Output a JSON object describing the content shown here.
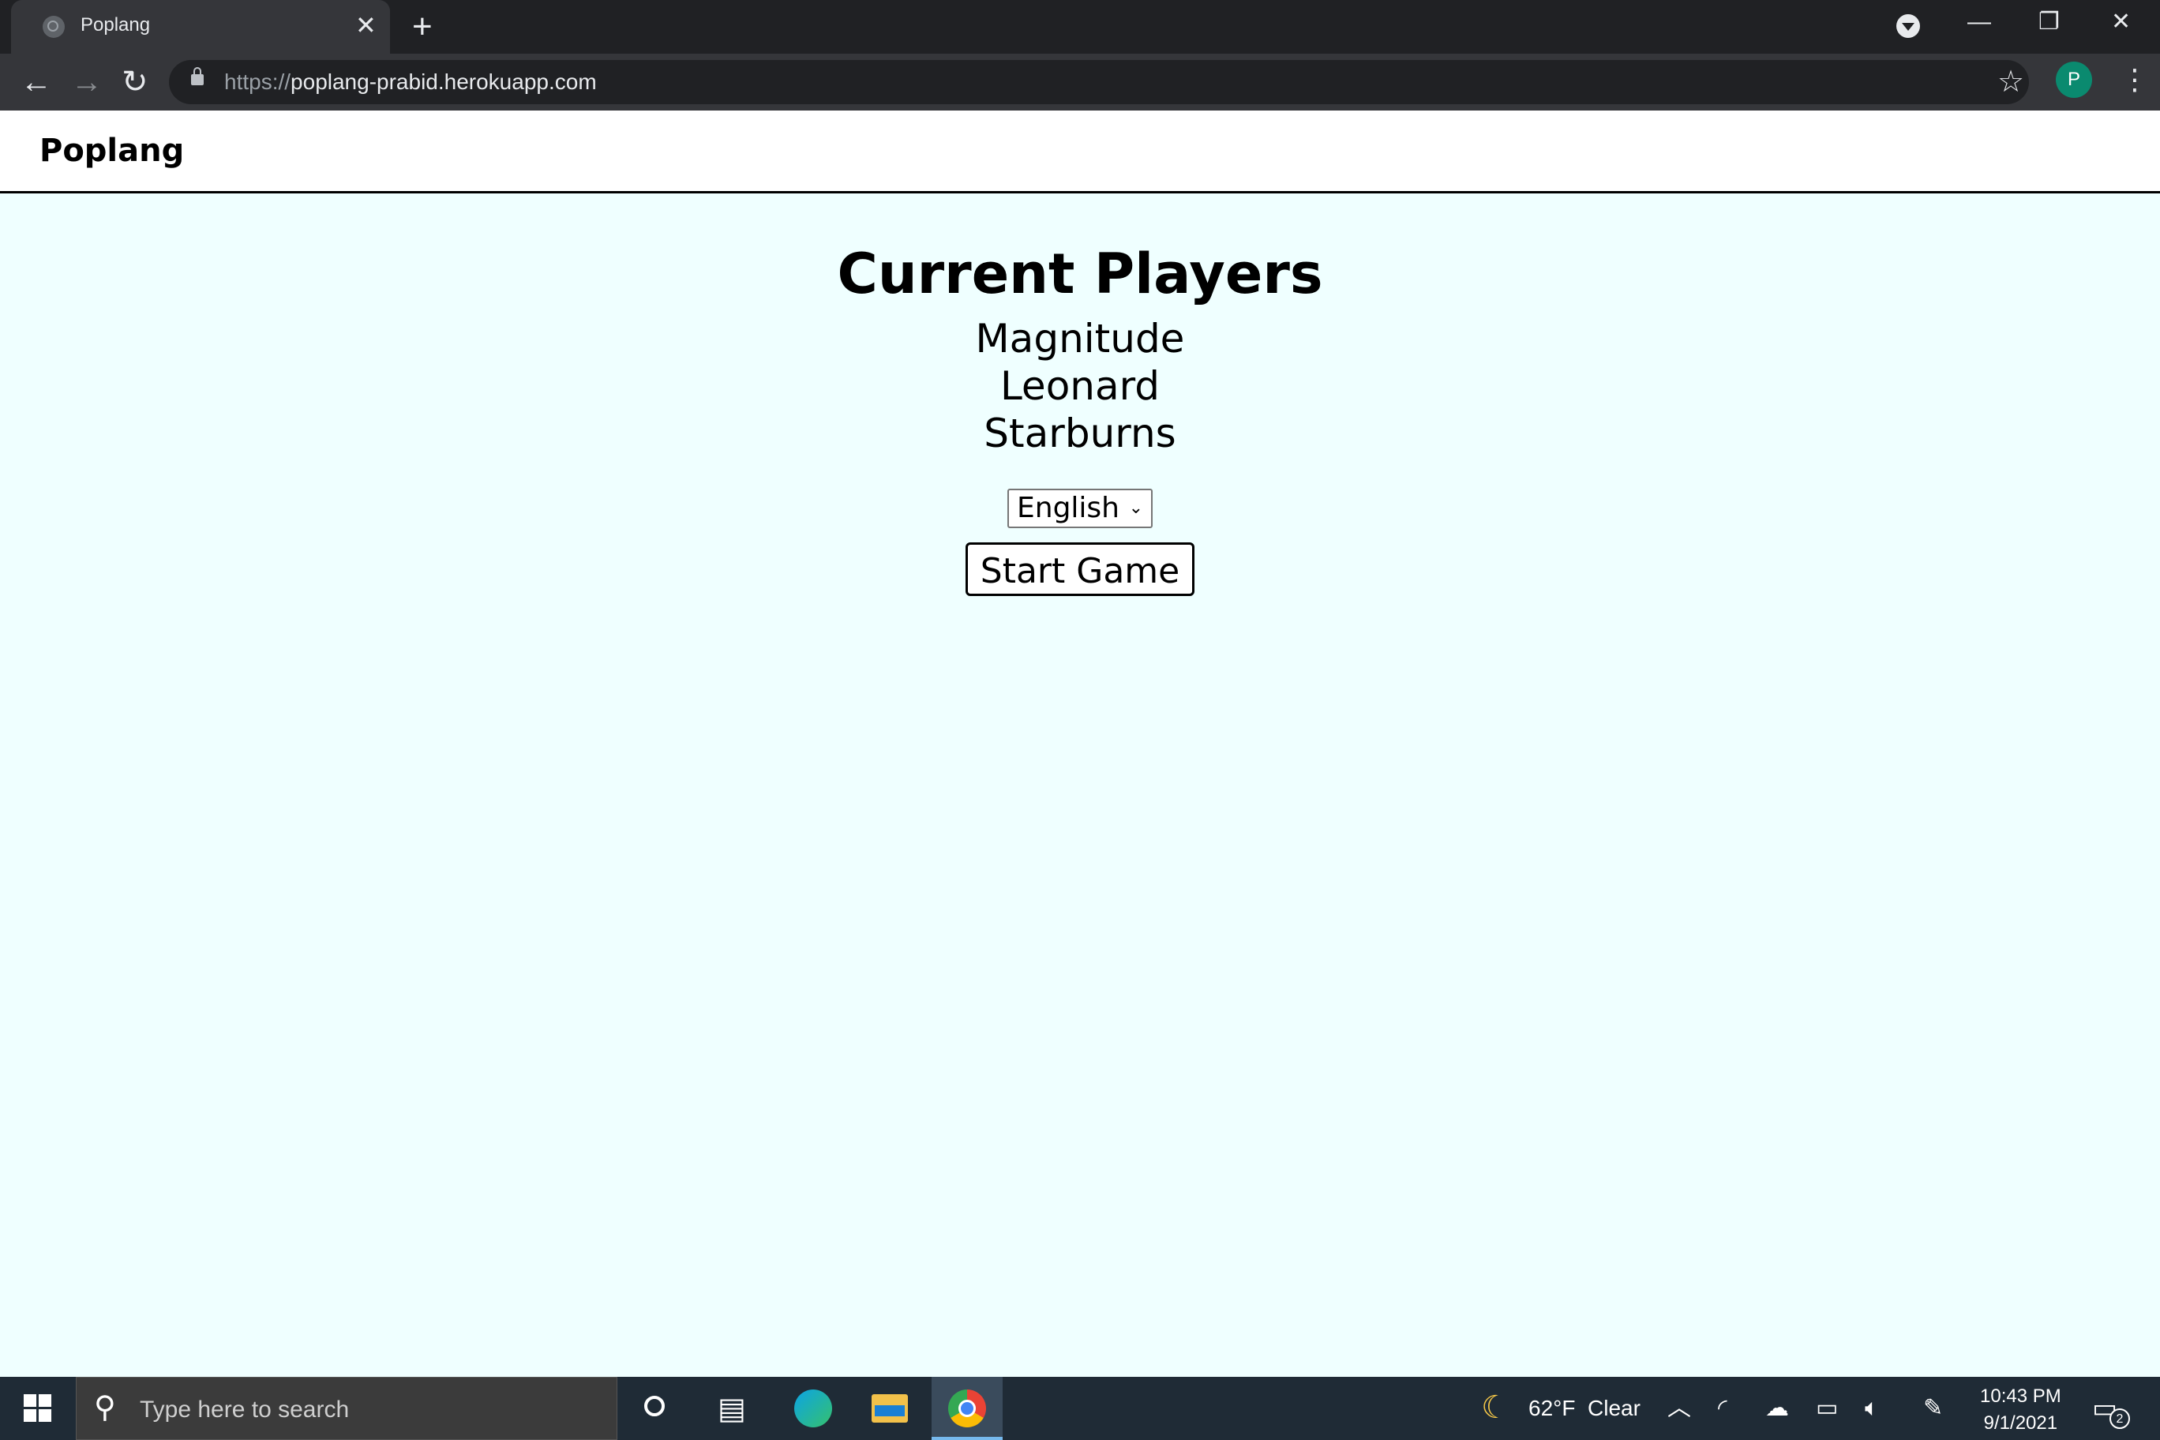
{
  "browser": {
    "tab_title": "Poplang",
    "tab_close": "✕",
    "new_tab": "+",
    "url_scheme": "https://",
    "url_host": "poplang-prabid.herokuapp.com",
    "profile_initial": "P",
    "window_controls": {
      "minimize": "—",
      "restore": "❐",
      "close": "✕"
    },
    "nav": {
      "back": "←",
      "forward": "→",
      "reload": "↻"
    },
    "icons": [
      "globe-icon",
      "lock-icon",
      "star-icon",
      "menu-icon",
      "profile-dropdown-icon"
    ]
  },
  "site": {
    "brand": "Poplang",
    "heading": "Current Players",
    "players": [
      "Magnitude",
      "Leonard",
      "Starburns"
    ],
    "language_select": {
      "selected": "English"
    },
    "start_button": "Start Game",
    "background": "#efffff"
  },
  "taskbar": {
    "search_placeholder": "Type here to search",
    "weather": {
      "temp": "62°F",
      "condition": "Clear"
    },
    "time": "10:43 PM",
    "date": "9/1/2021",
    "notification_count": "2",
    "pinned": [
      "cortana-icon",
      "task-view-icon",
      "edge-icon",
      "file-explorer-icon",
      "chrome-icon"
    ]
  }
}
